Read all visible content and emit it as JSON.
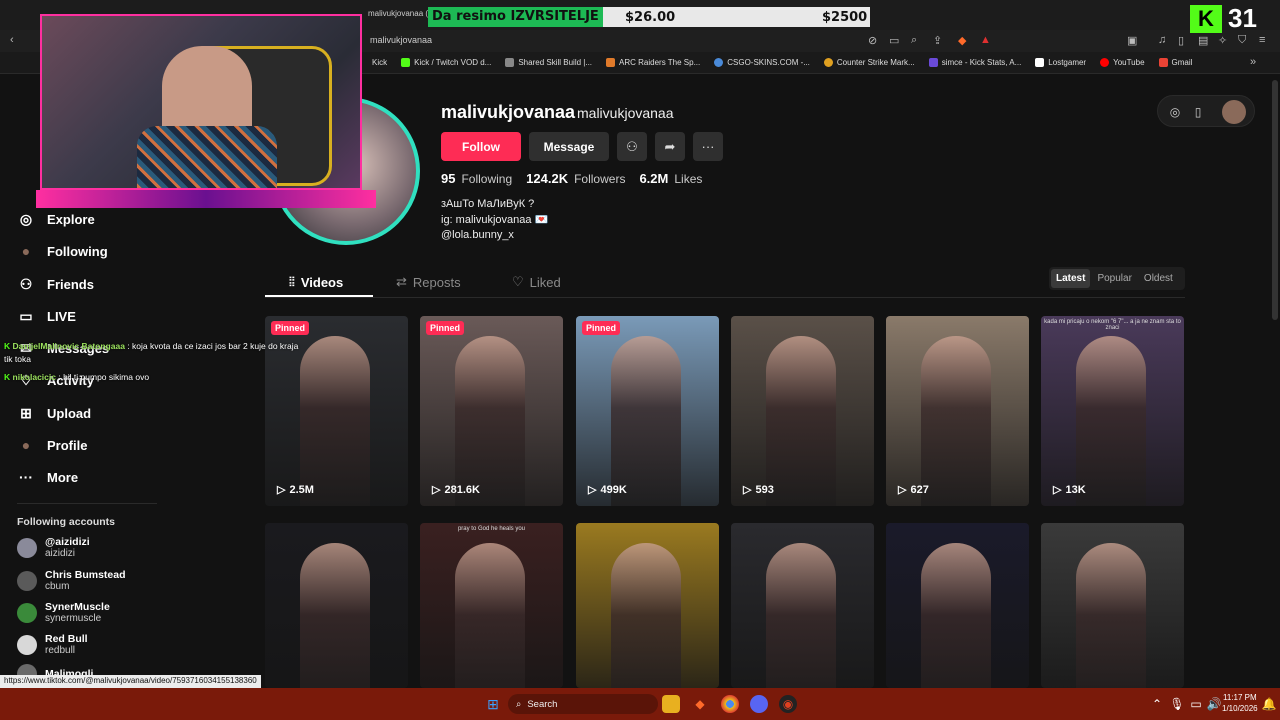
{
  "browser": {
    "tab_title": "malivukjovanaa (@m",
    "url": "malivukjovanaa",
    "bookmarks": [
      {
        "label": "Kick"
      },
      {
        "label": "Kick / Twitch VOD d..."
      },
      {
        "label": "Shared Skill Build |..."
      },
      {
        "label": "ARC Raiders The Sp..."
      },
      {
        "label": "CSGO-SKINS.COM -..."
      },
      {
        "label": "Counter Strike Mark..."
      },
      {
        "label": "simce - Kick Stats, A..."
      },
      {
        "label": "Lostgamer"
      },
      {
        "label": "YouTube"
      },
      {
        "label": "Gmail"
      }
    ]
  },
  "overlay": {
    "bet_label": "Da resimo IZVRSITELJE",
    "bet_amount": "$26.00",
    "bet_target": "$2500",
    "kick_letter": "K",
    "kick_count": "31"
  },
  "profile": {
    "username": "malivukjovanaa",
    "nickname": "malivukjovanaa",
    "follow_label": "Follow",
    "message_label": "Message",
    "following_count": "95",
    "following_label": "Following",
    "followers_count": "124.2K",
    "followers_label": "Followers",
    "likes_count": "6.2M",
    "likes_label": "Likes",
    "bio_line1": "зАшТо МаЛиВуК ?",
    "bio_line2": "ig: malivukjovanaa 💌",
    "bio_line3": "@lola.bunny_x"
  },
  "tabs": {
    "videos": "Videos",
    "reposts": "Reposts",
    "liked": "Liked"
  },
  "sort": {
    "latest": "Latest",
    "popular": "Popular",
    "oldest": "Oldest"
  },
  "videos": [
    {
      "pinned": "Pinned",
      "views": "2.5M",
      "color": "#2a2c30"
    },
    {
      "pinned": "Pinned",
      "views": "281.6K",
      "color": "#6a5a58"
    },
    {
      "pinned": "Pinned",
      "views": "499K",
      "color": "#7a9ab8"
    },
    {
      "views": "593",
      "color": "#5a5048"
    },
    {
      "views": "627",
      "color": "#8a7a6a"
    },
    {
      "views": "13K",
      "color": "#4a3a5a",
      "caption": "kada mi pricaju o nekom \"6 7\"... a ja ne znam sta to znaci"
    },
    {
      "color": "#1a1a1e"
    },
    {
      "color": "#3a2020",
      "caption": "pray to God he heals you"
    },
    {
      "color": "#9a7a20"
    },
    {
      "color": "#2a2a2e"
    },
    {
      "color": "#1a1a2a"
    },
    {
      "color": "#3a3a3a"
    }
  ],
  "sidebar": {
    "items": [
      {
        "label": "Explore",
        "icon": "compass-icon"
      },
      {
        "label": "Following",
        "icon": "following-avatar-icon"
      },
      {
        "label": "Friends",
        "icon": "friends-icon"
      },
      {
        "label": "LIVE",
        "icon": "live-tv-icon"
      },
      {
        "label": "Messages",
        "icon": "messages-icon"
      },
      {
        "label": "Activity",
        "icon": "activity-icon"
      },
      {
        "label": "Upload",
        "icon": "upload-icon"
      },
      {
        "label": "Profile",
        "icon": "profile-avatar-icon"
      },
      {
        "label": "More",
        "icon": "more-icon"
      }
    ],
    "following_title": "Following accounts",
    "accounts": [
      {
        "name": "@aizidizi",
        "handle": "aizidizi",
        "color": "#8a8a9a"
      },
      {
        "name": "Chris Bumstead",
        "handle": "cbum",
        "color": "#5a5a5a"
      },
      {
        "name": "SynerMuscle",
        "handle": "synermuscle",
        "color": "#3a8a3a"
      },
      {
        "name": "Red Bull",
        "handle": "redbull",
        "color": "#d8d8d8"
      },
      {
        "name": "Malimogli",
        "handle": "",
        "color": "#6a6a6a"
      }
    ]
  },
  "chat": [
    {
      "user": "DanijelMalinovic Batongaaa",
      "text": " : koja kvota da ce izaci jos bar 2 kuje do kraja tik toka"
    },
    {
      "user": "nikolacicic",
      "text": " : hil ti pumpo sikima ovo"
    }
  ],
  "status_url": "https://www.tiktok.com/@malivukjovanaa/video/7593716034155138360",
  "taskbar": {
    "search_label": "Search",
    "time": "11:17 PM",
    "date": "1/10/2026"
  }
}
